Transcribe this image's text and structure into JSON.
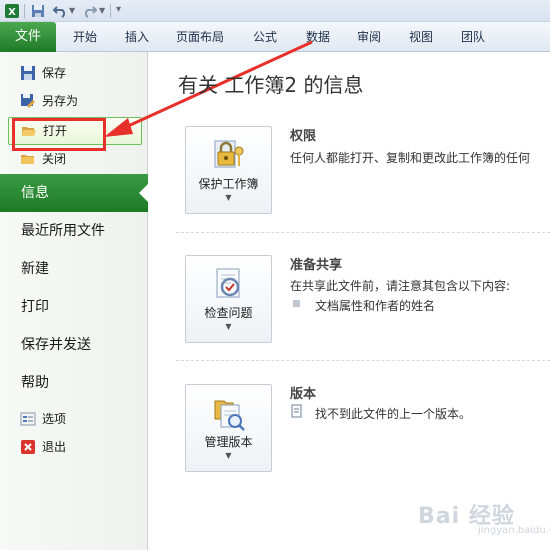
{
  "ribbon": {
    "tabs": [
      "文件",
      "开始",
      "插入",
      "页面布局",
      "公式",
      "数据",
      "审阅",
      "视图",
      "团队"
    ]
  },
  "backstage": {
    "save": "保存",
    "save_as": "另存为",
    "open": "打开",
    "close": "关闭",
    "info": "信息",
    "recent": "最近所用文件",
    "new": "新建",
    "print": "打印",
    "save_send": "保存并发送",
    "help": "帮助",
    "options": "选项",
    "exit": "退出"
  },
  "info": {
    "title": "有关 工作簿2 的信息",
    "permissions": {
      "button": "保护工作簿",
      "heading": "权限",
      "desc": "任何人都能打开、复制和更改此工作簿的任何"
    },
    "prepare": {
      "button": "检查问题",
      "heading": "准备共享",
      "desc": "在共享此文件前，请注意其包含以下内容:",
      "bullet": "文档属性和作者的姓名"
    },
    "versions": {
      "button": "管理版本",
      "heading": "版本",
      "desc": "找不到此文件的上一个版本。"
    }
  },
  "watermark": {
    "logo": "Bai 经验",
    "url": "jingyan.baidu.com"
  },
  "colors": {
    "file_tab": "#2a8a31",
    "active_item": "#2a8a31",
    "annotation": "#e8302a"
  }
}
